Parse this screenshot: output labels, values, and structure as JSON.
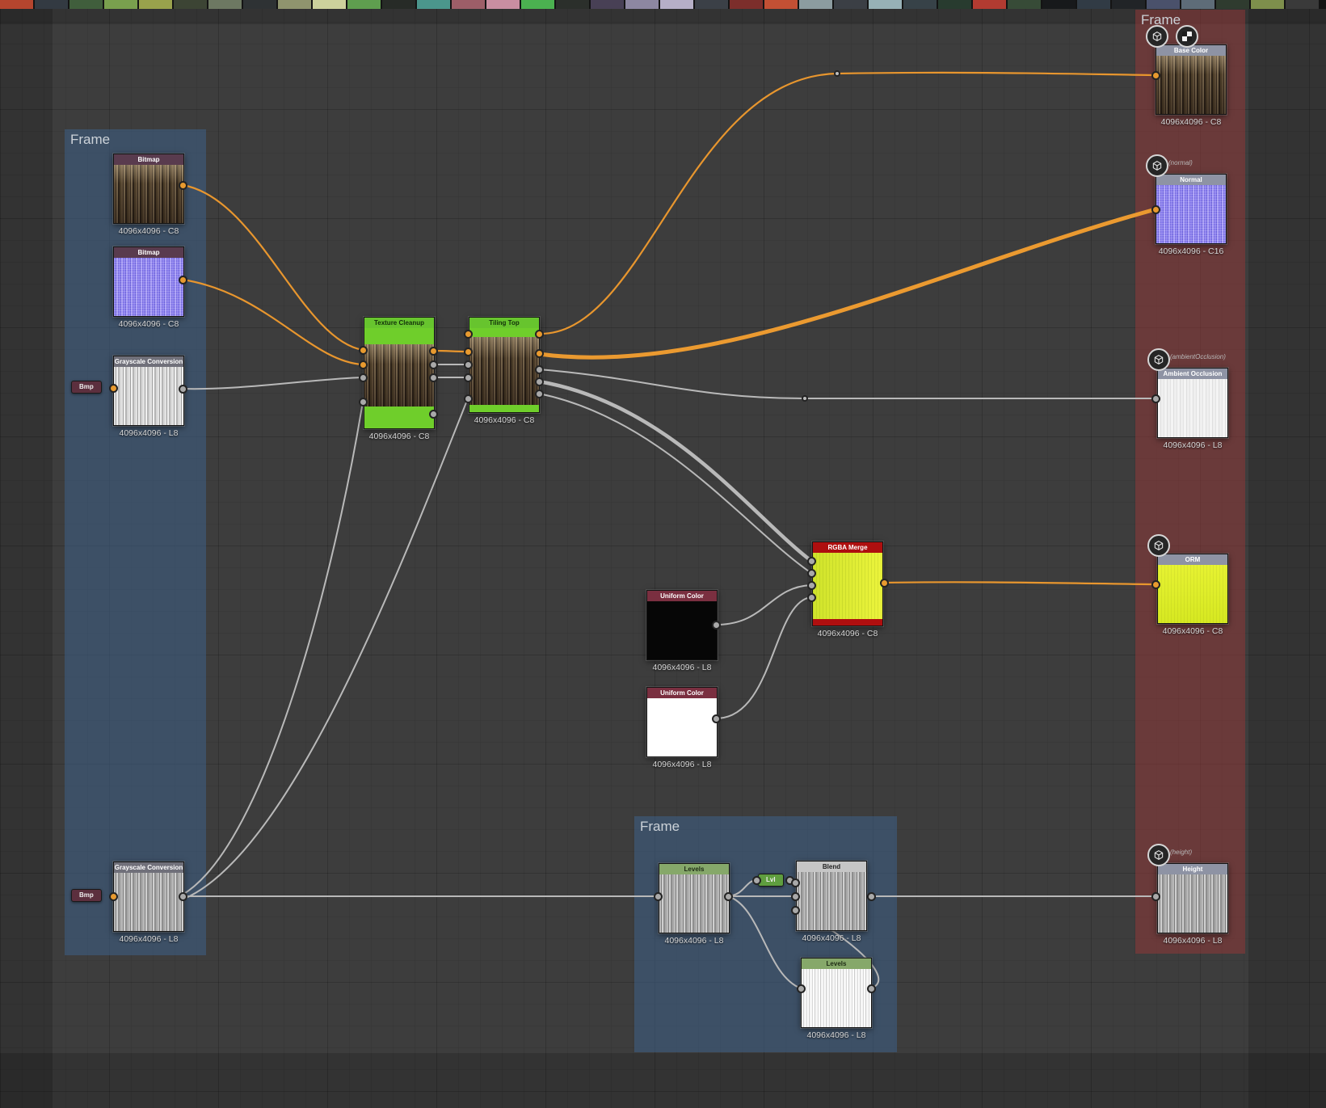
{
  "palette": [
    "#b5452e",
    "#333a42",
    "#405e3c",
    "#79a04e",
    "#99a24c",
    "#3c4434",
    "#6d7862",
    "#2e3234",
    "#8f946e",
    "#ccd19c",
    "#5f9e4f",
    "#272b27",
    "#4b968c",
    "#9d5e68",
    "#c98ea1",
    "#4bb150",
    "#2b2f2b",
    "#484055",
    "#8d87a1",
    "#b6afc7",
    "#3b4047",
    "#7c2e2b",
    "#c35034",
    "#8c9ca0",
    "#3b3f45",
    "#97b1b6",
    "#374248",
    "#283b2f",
    "#b23b31",
    "#374b37",
    "#17191b",
    "#313b45",
    "#212427",
    "#4a516b",
    "#5e6c78",
    "#2f3b2f",
    "#7e8f4c",
    "#3a3a3a"
  ],
  "frames": {
    "left": {
      "label": "Frame"
    },
    "right": {
      "label": "Frame"
    },
    "bottom": {
      "label": "Frame"
    }
  },
  "nodes": {
    "bitmap1": {
      "title": "Bitmap",
      "caption": "4096x4096 - C8"
    },
    "bitmap2": {
      "title": "Bitmap",
      "caption": "4096x4096 - C8"
    },
    "grayscale1": {
      "title": "Grayscale Conversion",
      "caption": "4096x4096 - L8",
      "tag": "Bmp"
    },
    "grayscale2": {
      "title": "Grayscale Conversion",
      "caption": "4096x4096 - L8",
      "tag": "Bmp"
    },
    "texture_cleanup": {
      "title": "Texture Cleanup",
      "caption": "4096x4096 - C8"
    },
    "tiling_top": {
      "title": "Tiling Top",
      "caption": "4096x4096 - C8"
    },
    "rgba_merge": {
      "title": "RGBA Merge",
      "caption": "4096x4096 - C8"
    },
    "uniform_black": {
      "title": "Uniform Color",
      "caption": "4096x4096 - L8"
    },
    "uniform_white": {
      "title": "Uniform Color",
      "caption": "4096x4096 - L8"
    },
    "levels1": {
      "title": "Levels",
      "caption": "4096x4096 - L8"
    },
    "lvl_tag": {
      "label": "Lvl"
    },
    "blend": {
      "title": "Blend",
      "caption": "4096x4096 - L8"
    },
    "levels2": {
      "title": "Levels",
      "caption": "4096x4096 - L8"
    },
    "out_basecolor": {
      "title": "Base Color",
      "caption": "4096x4096 - C8"
    },
    "out_normal": {
      "title": "Normal",
      "sublabel": "(normal)",
      "caption": "4096x4096 - C16"
    },
    "out_ao": {
      "title": "Ambient Occlusion",
      "sublabel": "(ambientOcclusion)",
      "caption": "4096x4096 - L8"
    },
    "out_orm": {
      "title": "ORM",
      "caption": "4096x4096 - C8"
    },
    "out_height": {
      "title": "Height",
      "sublabel": "(height)",
      "caption": "4096x4096 - L8"
    }
  },
  "colors": {
    "wire_orange": "#e8962e",
    "wire_gray": "#b9b9b9",
    "frame_blue": "#3e6088",
    "frame_red": "#943838",
    "node_green": "#6fce2b"
  }
}
